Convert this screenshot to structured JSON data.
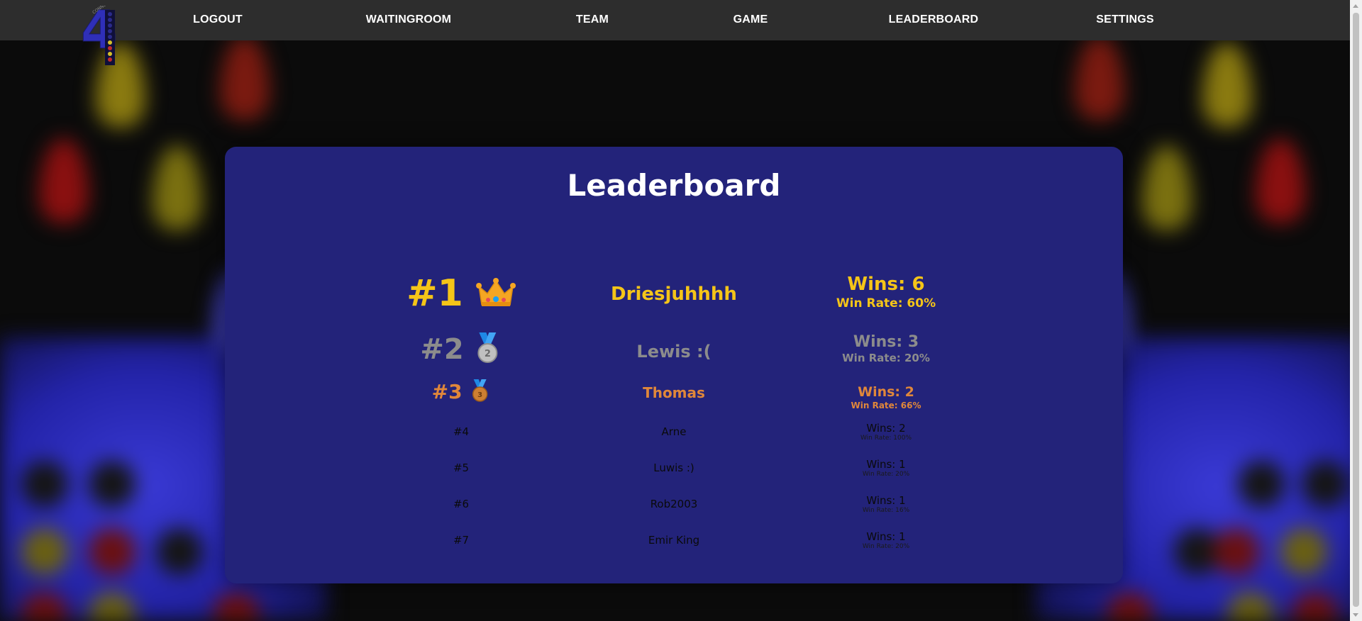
{
  "nav": {
    "items": [
      "LOGOUT",
      "WAITINGROOM",
      "TEAM",
      "GAME",
      "LEADERBOARD",
      "SETTINGS"
    ]
  },
  "leaderboard": {
    "title": "Leaderboard",
    "entries": [
      {
        "rank": "#1",
        "icon": "crown-icon",
        "name": "Driesjuhhhh",
        "wins": "Wins: 6",
        "win_rate": "Win Rate: 60%"
      },
      {
        "rank": "#2",
        "icon": "silver-medal-icon",
        "name": "Lewis :(",
        "wins": "Wins: 3",
        "win_rate": "Win Rate: 20%"
      },
      {
        "rank": "#3",
        "icon": "bronze-medal-icon",
        "name": "Thomas",
        "wins": "Wins: 2",
        "win_rate": "Win Rate: 66%"
      },
      {
        "rank": "#4",
        "name": "Arne",
        "wins": "Wins: 2",
        "win_rate": "Win Rate: 100%"
      },
      {
        "rank": "#5",
        "name": "Luwis :)",
        "wins": "Wins: 1",
        "win_rate": "Win Rate: 20%"
      },
      {
        "rank": "#6",
        "name": "Rob2003",
        "wins": "Wins: 1",
        "win_rate": "Win Rate: 16%"
      },
      {
        "rank": "#7",
        "name": "Emir King",
        "wins": "Wins: 1",
        "win_rate": "Win Rate: 20%"
      }
    ]
  },
  "colors": {
    "gold": "#f5c518",
    "silver": "#8c8c8c",
    "bronze": "#e0873a",
    "card": "#23237a",
    "nav": "#2d2d2d"
  }
}
